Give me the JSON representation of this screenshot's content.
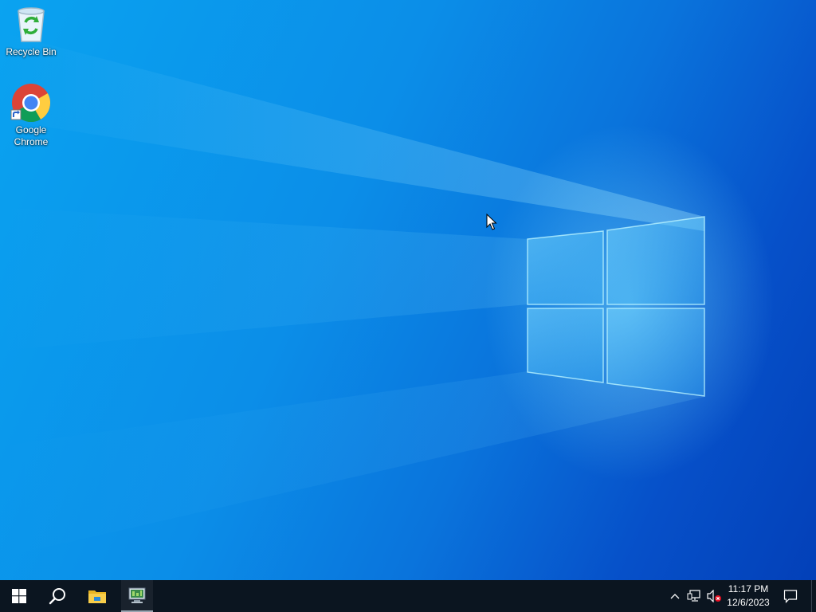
{
  "desktop": {
    "icons": [
      {
        "label": "Recycle Bin",
        "icon": "recycle-bin-icon"
      },
      {
        "label": "Google\nChrome",
        "icon": "chrome-icon",
        "shortcut": true
      }
    ],
    "colors": {
      "wallpaper_light": "#0aa3f0",
      "wallpaper_dark": "#0340b8",
      "logo_glow": "#78dcff"
    }
  },
  "taskbar": {
    "start": "windows-start-icon",
    "search": "search-icon",
    "pinned": [
      {
        "name": "File Explorer",
        "icon": "folder-icon"
      },
      {
        "name": "Server Manager",
        "icon": "server-manager-icon",
        "active": true
      }
    ],
    "tray": {
      "icons": [
        "chevron-up-icon",
        "network-icon",
        "volume-muted-icon"
      ],
      "time": "11:17 PM",
      "date": "12/6/2023"
    },
    "notifications": "action-center-icon",
    "background": "#0b1520"
  }
}
